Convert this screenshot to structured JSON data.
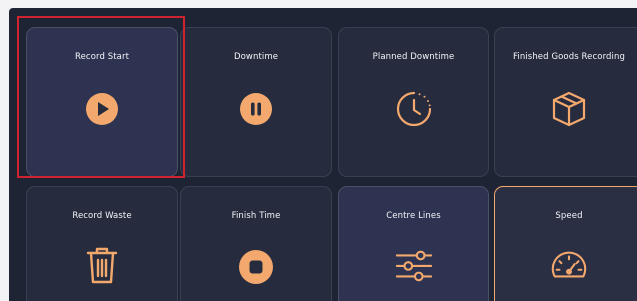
{
  "tiles": [
    {
      "label": "Record Start",
      "icon": "play-circle-icon"
    },
    {
      "label": "Downtime",
      "icon": "pause-circle-icon"
    },
    {
      "label": "Planned Downtime",
      "icon": "clock-icon"
    },
    {
      "label": "Finished Goods Recording",
      "icon": "box-icon"
    },
    {
      "label": "Record Waste",
      "icon": "trash-icon"
    },
    {
      "label": "Finish Time",
      "icon": "stop-circle-icon"
    },
    {
      "label": "Centre Lines",
      "icon": "sliders-icon"
    },
    {
      "label": "Speed",
      "icon": "speedometer-icon"
    }
  ],
  "colors": {
    "accent": "#f3a86d",
    "background": "#1f2434",
    "tile": "#262b3d",
    "highlight": "#d1232f"
  }
}
